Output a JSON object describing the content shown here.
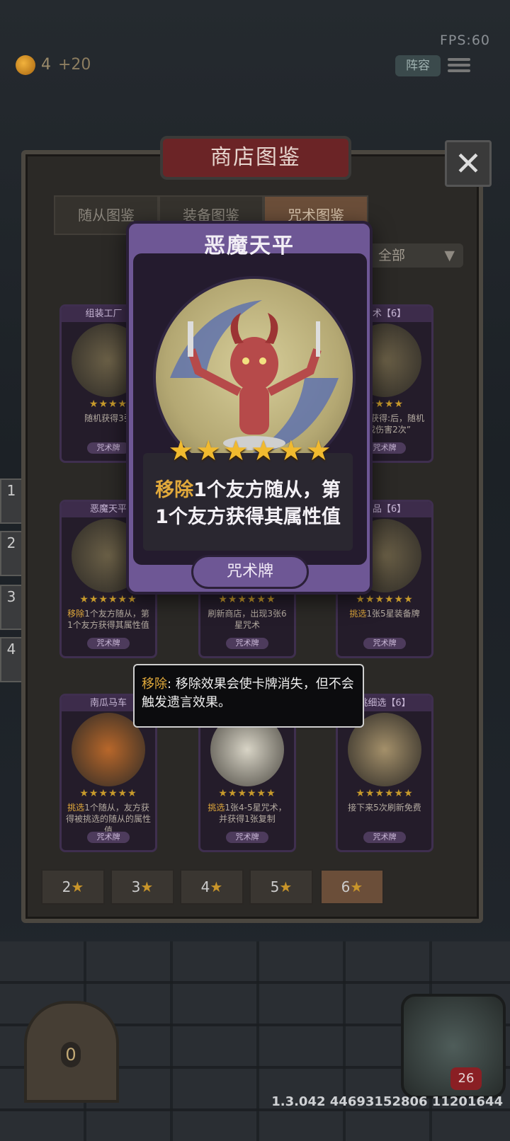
{
  "hud": {
    "fps": "FPS:60",
    "gold": "4",
    "gold_plus": "+20",
    "lineup_label": "阵容",
    "hp": "26",
    "door_count": "0",
    "version": "1.3.042 44693152806 11201644"
  },
  "panel": {
    "title": "商店图鉴",
    "close_label": "✕",
    "tabs": [
      "随从图鉴",
      "装备图鉴",
      "咒术图鉴"
    ],
    "active_tab": "咒术图鉴",
    "filter_label": "全部",
    "star_tabs": [
      {
        "num": "2",
        "star": "★"
      },
      {
        "num": "3",
        "star": "★"
      },
      {
        "num": "4",
        "star": "★"
      },
      {
        "num": "5",
        "star": "★"
      },
      {
        "num": "6",
        "star": "★"
      }
    ],
    "active_star_tab": "6"
  },
  "side_levels": [
    "1",
    "2",
    "3",
    "4"
  ],
  "cards": [
    {
      "name": "组装工厂【",
      "stars": "★★★★",
      "desc": "随机获得3张",
      "type": "咒术牌"
    },
    {
      "name": "刺术【6】",
      "stars": "★★★★",
      "desc": "个友方获得:后，随机造成伤害2次”",
      "type": "咒术牌"
    },
    {
      "name": "恶魔天平",
      "stars": "★★★★★★",
      "desc_hl": "移除",
      "desc": "1个友方随从，第1个友方获得其属性值",
      "type": "咒术牌"
    },
    {
      "name": "",
      "stars": "★★★★★★",
      "desc": "刷新商店，出现3张6星咒术",
      "type": "咒术牌"
    },
    {
      "name": "藏品【6】",
      "stars": "★★★★★★",
      "desc_hl": "挑选",
      "desc": "1张5星装备牌",
      "type": "咒术牌"
    },
    {
      "name": "南瓜马车",
      "stars": "★★★★★★",
      "desc_hl": "挑选",
      "desc": "1个随从，友方获得被挑选的随从的属性值",
      "type": "咒术牌"
    },
    {
      "name": "",
      "stars": "★★★★★★",
      "desc_hl": "挑选",
      "desc": "1张4-5星咒术，并获得1张复制",
      "type": "咒术牌"
    },
    {
      "name": "挑细选【6】",
      "stars": "★★★★★★",
      "desc": "接下来5次刷新免费",
      "type": "咒术牌"
    }
  ],
  "big_card": {
    "name": "恶魔天平",
    "stars": "★★★★★★",
    "desc_hl": "移除",
    "desc_line1": "1个友方随从，第",
    "desc_line2": "1个友方获得其属性值",
    "type": "咒术牌"
  },
  "tooltip": {
    "keyword": "移除",
    "text": ": 移除效果会使卡牌消失，但不会触发遗言效果。"
  }
}
